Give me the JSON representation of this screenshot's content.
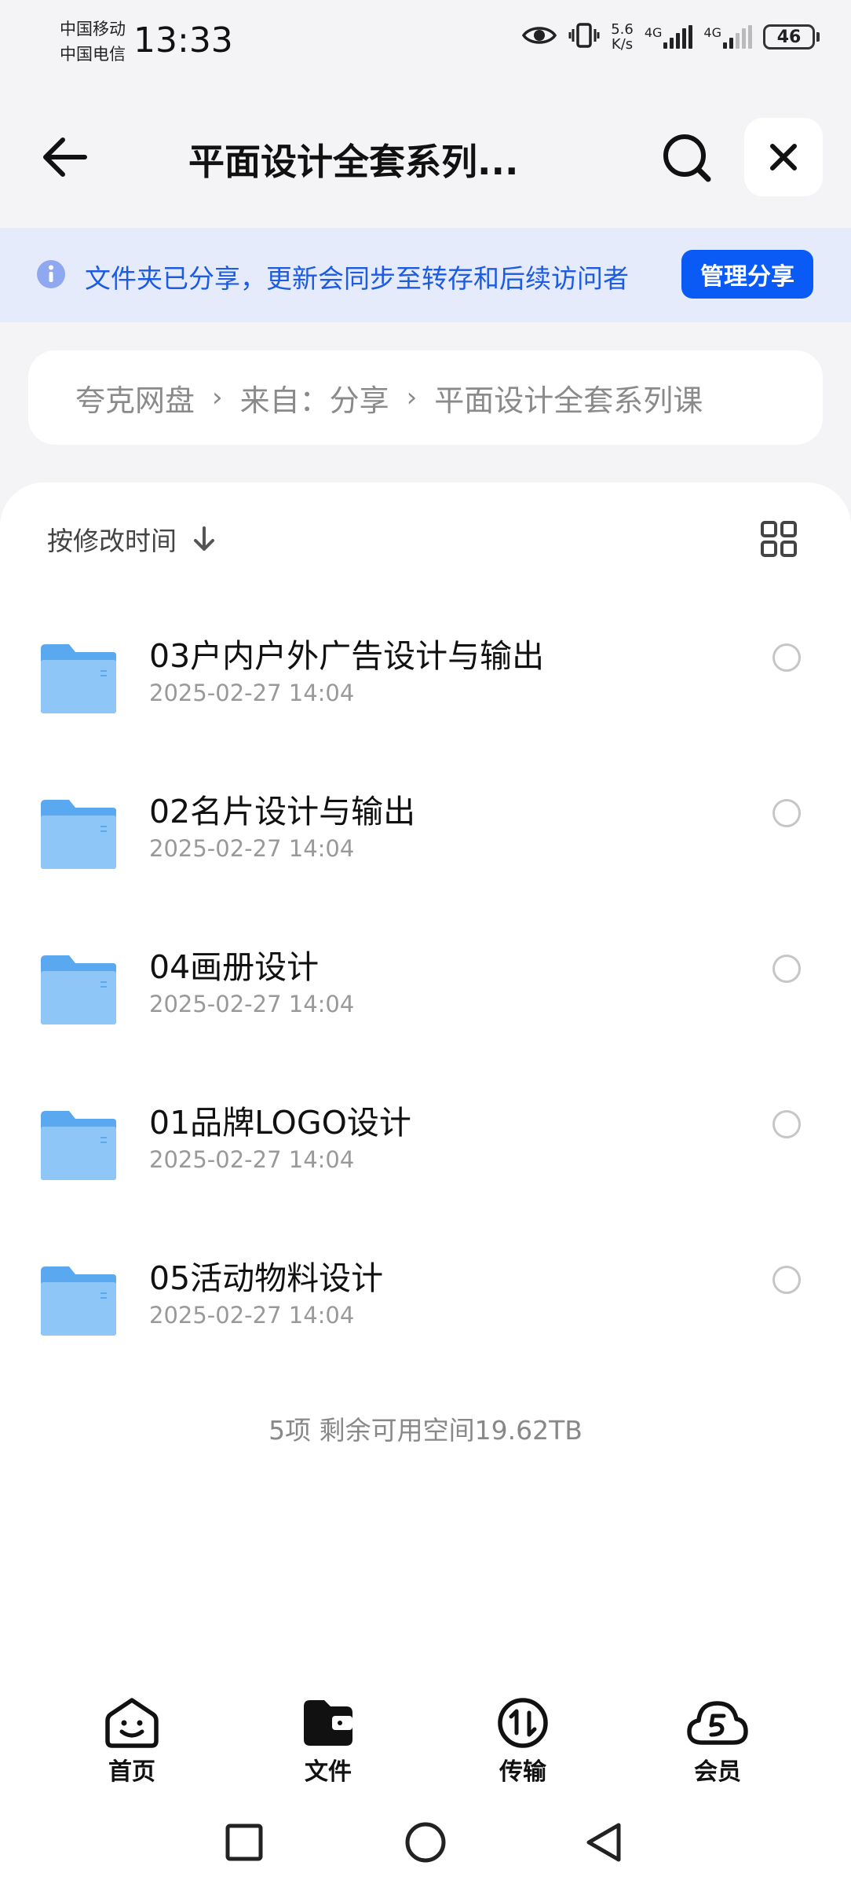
{
  "status_bar": {
    "carrier_1": "中国移动",
    "carrier_2": "中国电信",
    "time": "13:33",
    "net_speed_value": "5.6",
    "net_speed_unit": "K/s",
    "signal_label_1": "4G",
    "signal_label_2": "4G",
    "battery": "46"
  },
  "header": {
    "title": "平面设计全套系列..."
  },
  "banner": {
    "text": "文件夹已分享，更新会同步至转存和后续访问者",
    "button": "管理分享"
  },
  "breadcrumb": {
    "items": [
      "夸克网盘",
      "来自：分享",
      "平面设计全套系列课"
    ]
  },
  "sort": {
    "label": "按修改时间"
  },
  "files": [
    {
      "name": "03户内户外广告设计与输出",
      "date": "2025-02-27 14:04"
    },
    {
      "name": "02名片设计与输出",
      "date": "2025-02-27 14:04"
    },
    {
      "name": "04画册设计",
      "date": "2025-02-27 14:04"
    },
    {
      "name": "01品牌LOGO设计",
      "date": "2025-02-27 14:04"
    },
    {
      "name": "05活动物料设计",
      "date": "2025-02-27 14:04"
    }
  ],
  "summary": "5项 剩余可用空间19.62TB",
  "nav": {
    "home": "首页",
    "files": "文件",
    "transfer": "传输",
    "member": "会员"
  },
  "colors": {
    "accent": "#0a5af5",
    "banner_bg": "#e6ebfb",
    "banner_text": "#1d5be0",
    "folder": "#5aa8f0"
  }
}
